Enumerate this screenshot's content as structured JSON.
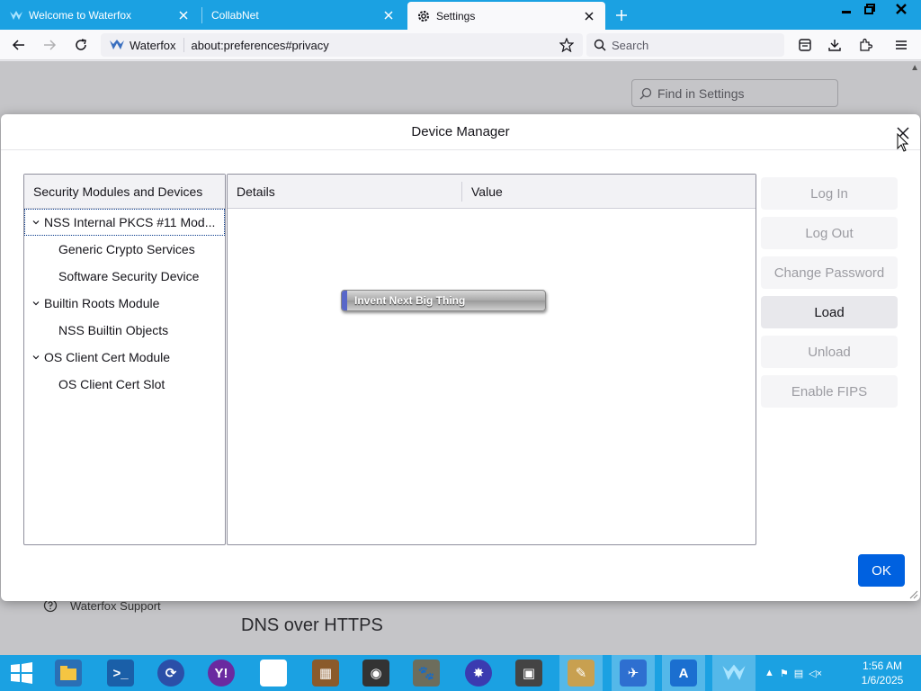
{
  "browser": {
    "tabs": [
      {
        "label": "Welcome to Waterfox",
        "icon": "waterfox-icon"
      },
      {
        "label": "CollabNet",
        "icon": ""
      },
      {
        "label": "Settings",
        "icon": "gear-icon"
      }
    ],
    "urlbar": {
      "site_label": "Waterfox",
      "url": "about:preferences#privacy"
    },
    "search_placeholder": "Search"
  },
  "page": {
    "find_placeholder": "Find in Settings",
    "support_label": "Waterfox Support",
    "dns_heading": "DNS over HTTPS"
  },
  "dialog": {
    "title": "Device Manager",
    "tree_header": "Security Modules and Devices",
    "tree": [
      {
        "label": "NSS Internal PKCS #11 Mod...",
        "level": 0,
        "expanded": true,
        "selected": true
      },
      {
        "label": "Generic Crypto Services",
        "level": 1
      },
      {
        "label": "Software Security Device",
        "level": 1
      },
      {
        "label": "Builtin Roots Module",
        "level": 0,
        "expanded": true
      },
      {
        "label": "NSS Builtin Objects",
        "level": 1
      },
      {
        "label": "OS Client Cert Module",
        "level": 0,
        "expanded": true
      },
      {
        "label": "OS Client Cert Slot",
        "level": 1
      }
    ],
    "details_header": "Details",
    "value_header": "Value",
    "overlay_button": "Invent Next Big Thing",
    "buttons": {
      "log_in": "Log In",
      "log_out": "Log Out",
      "change_password": "Change Password",
      "load": "Load",
      "unload": "Unload",
      "enable_fips": "Enable FIPS",
      "ok": "OK"
    }
  },
  "taskbar": {
    "clock_time": "1:56 AM",
    "clock_date": "1/6/2025"
  },
  "colors": {
    "accent": "#1ba1e2",
    "primary_button": "#0061e0"
  }
}
